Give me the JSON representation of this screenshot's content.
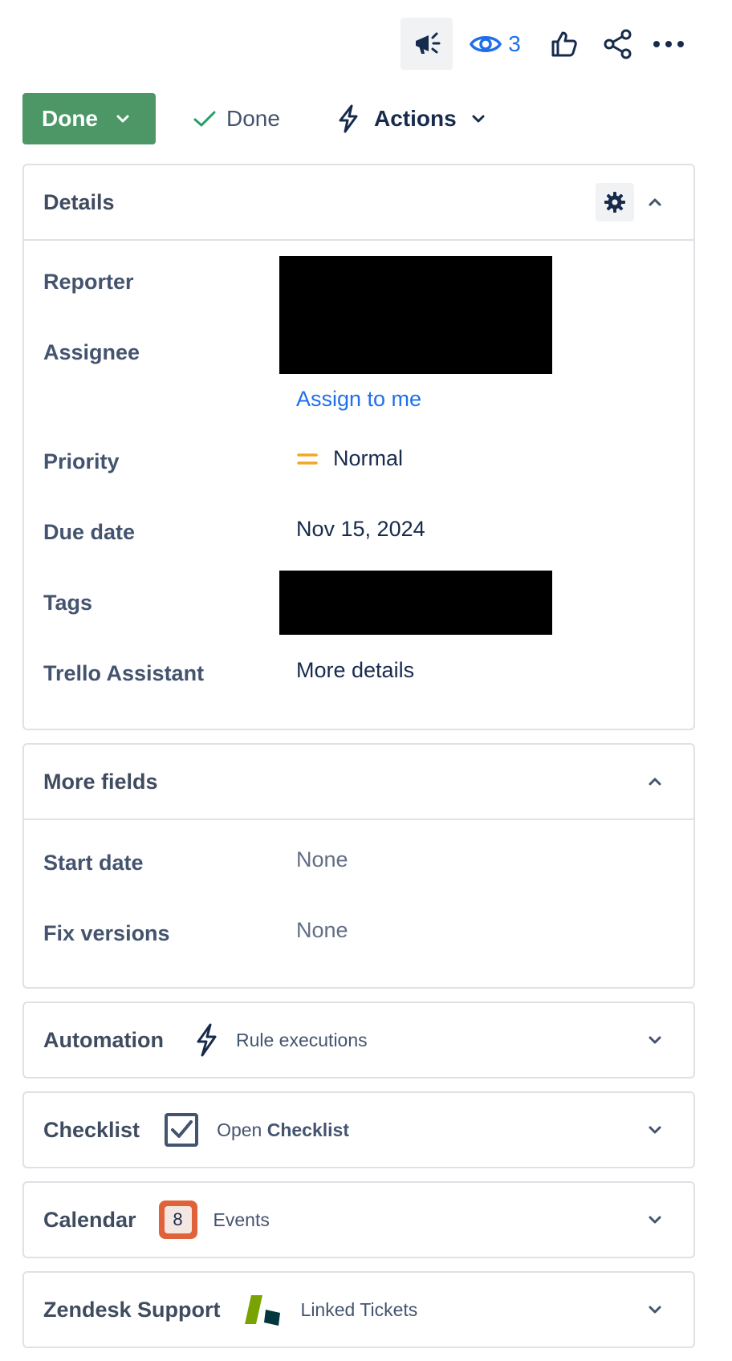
{
  "topbar": {
    "watch_count": "3"
  },
  "status": {
    "current": "Done",
    "resolution": "Done",
    "actions_label": "Actions"
  },
  "details": {
    "title": "Details",
    "reporter_label": "Reporter",
    "assignee_label": "Assignee",
    "assign_to_me": "Assign to me",
    "priority_label": "Priority",
    "priority_value": "Normal",
    "due_date_label": "Due date",
    "due_date_value": "Nov 15, 2024",
    "tags_label": "Tags",
    "trello_label": "Trello Assistant",
    "trello_value": "More details"
  },
  "more_fields": {
    "title": "More fields",
    "start_date_label": "Start date",
    "start_date_value": "None",
    "fix_versions_label": "Fix versions",
    "fix_versions_value": "None"
  },
  "apps": {
    "automation": {
      "title": "Automation",
      "sub": "Rule executions"
    },
    "checklist": {
      "title": "Checklist",
      "sub_prefix": "Open ",
      "sub_bold": "Checklist"
    },
    "calendar": {
      "title": "Calendar",
      "sub": "Events",
      "badge": "8"
    },
    "zendesk": {
      "title": "Zendesk Support",
      "sub": "Linked Tickets"
    }
  },
  "colors": {
    "status_green": "#4d9767",
    "link_blue": "#1f6feb",
    "priority_orange": "#f5a623",
    "calendar_orange": "#e0623a",
    "zendesk_green": "#78a300",
    "zendesk_dark": "#03363d"
  }
}
